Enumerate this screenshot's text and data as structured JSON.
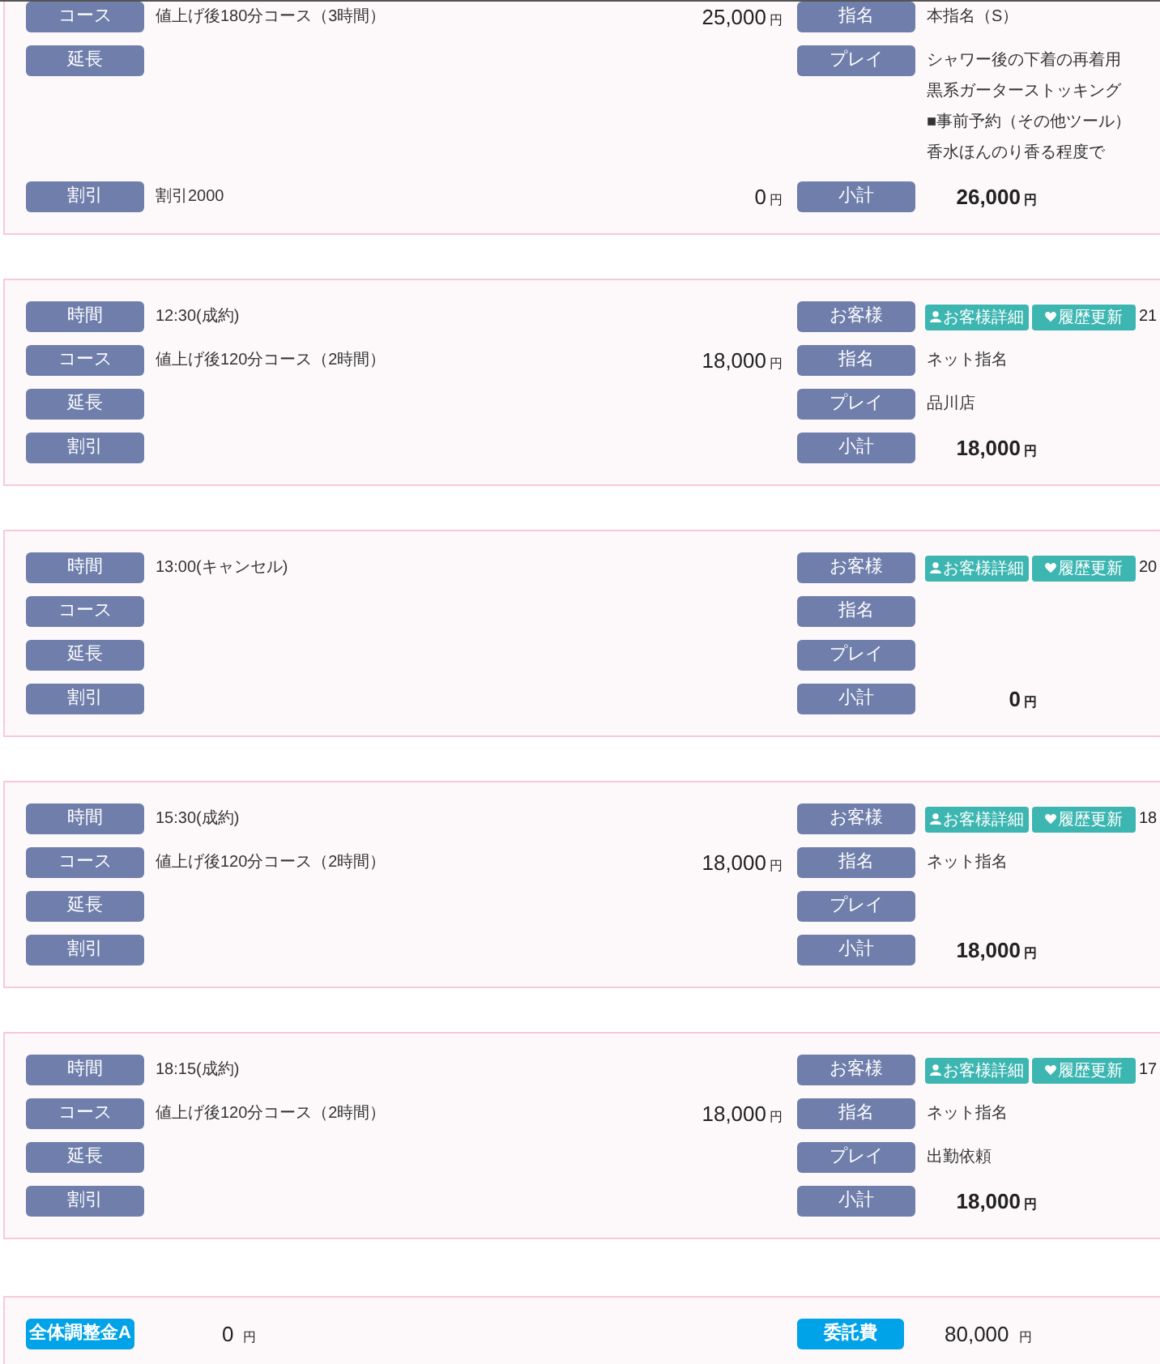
{
  "cards": [
    {
      "rows": [
        {
          "left": {
            "label": "コース",
            "value": "値上げ後180分コース（3時間）",
            "price": "25,000",
            "unit": "円"
          },
          "right": {
            "kind": "text",
            "label": "指名",
            "lines": [
              "本指名（S）"
            ]
          }
        },
        {
          "left": {
            "label": "延長"
          },
          "right": {
            "kind": "text",
            "label": "プレイ",
            "lines": [
              "シャワー後の下着の再着用",
              "黒系ガーターストッキング",
              "■事前予約（その他ツール）",
              "香水ほんのり香る程度で"
            ]
          }
        },
        {
          "left": {
            "label": "割引",
            "value": "割引2000",
            "price": "0",
            "unit": "円"
          },
          "right": {
            "kind": "total",
            "label": "小計",
            "value": "26,000",
            "unit": "円"
          }
        }
      ]
    },
    {
      "rows": [
        {
          "left": {
            "label": "時間",
            "value": "12:30(成約)"
          },
          "right": {
            "kind": "customer",
            "label": "お客様",
            "buttons": [
              "お客様詳細",
              "履歴更新"
            ],
            "value": "21"
          }
        },
        {
          "left": {
            "label": "コース",
            "value": "値上げ後120分コース（2時間）",
            "price": "18,000",
            "unit": "円"
          },
          "right": {
            "kind": "text",
            "label": "指名",
            "lines": [
              "ネット指名"
            ]
          }
        },
        {
          "left": {
            "label": "延長"
          },
          "right": {
            "kind": "text",
            "label": "プレイ",
            "lines": [
              "品川店"
            ]
          }
        },
        {
          "left": {
            "label": "割引"
          },
          "right": {
            "kind": "total",
            "label": "小計",
            "value": "18,000",
            "unit": "円"
          }
        }
      ]
    },
    {
      "rows": [
        {
          "left": {
            "label": "時間",
            "value": "13:00(キャンセル)"
          },
          "right": {
            "kind": "customer",
            "label": "お客様",
            "buttons": [
              "お客様詳細",
              "履歴更新"
            ],
            "value": "20"
          }
        },
        {
          "left": {
            "label": "コース"
          },
          "right": {
            "kind": "text",
            "label": "指名"
          }
        },
        {
          "left": {
            "label": "延長"
          },
          "right": {
            "kind": "text",
            "label": "プレイ"
          }
        },
        {
          "left": {
            "label": "割引"
          },
          "right": {
            "kind": "total",
            "label": "小計",
            "value": "0",
            "unit": "円"
          }
        }
      ]
    },
    {
      "rows": [
        {
          "left": {
            "label": "時間",
            "value": "15:30(成約)"
          },
          "right": {
            "kind": "customer",
            "label": "お客様",
            "buttons": [
              "お客様詳細",
              "履歴更新"
            ],
            "value": "18"
          }
        },
        {
          "left": {
            "label": "コース",
            "value": "値上げ後120分コース（2時間）",
            "price": "18,000",
            "unit": "円"
          },
          "right": {
            "kind": "text",
            "label": "指名",
            "lines": [
              "ネット指名"
            ]
          }
        },
        {
          "left": {
            "label": "延長"
          },
          "right": {
            "kind": "text",
            "label": "プレイ"
          }
        },
        {
          "left": {
            "label": "割引"
          },
          "right": {
            "kind": "total",
            "label": "小計",
            "value": "18,000",
            "unit": "円"
          }
        }
      ]
    },
    {
      "rows": [
        {
          "left": {
            "label": "時間",
            "value": "18:15(成約)"
          },
          "right": {
            "kind": "customer",
            "label": "お客様",
            "buttons": [
              "お客様詳細",
              "履歴更新"
            ],
            "value": "17"
          }
        },
        {
          "left": {
            "label": "コース",
            "value": "値上げ後120分コース（2時間）",
            "price": "18,000",
            "unit": "円"
          },
          "right": {
            "kind": "text",
            "label": "指名",
            "lines": [
              "ネット指名"
            ]
          }
        },
        {
          "left": {
            "label": "延長"
          },
          "right": {
            "kind": "text",
            "label": "プレイ",
            "lines": [
              "出勤依頼"
            ]
          }
        },
        {
          "left": {
            "label": "割引"
          },
          "right": {
            "kind": "total",
            "label": "小計",
            "value": "18,000",
            "unit": "円"
          }
        }
      ]
    }
  ],
  "summary": {
    "items": [
      {
        "label": "全体調整金A",
        "value": "0",
        "unit": "円"
      },
      {
        "label": "委託費",
        "value": "80,000",
        "unit": "円"
      }
    ]
  }
}
